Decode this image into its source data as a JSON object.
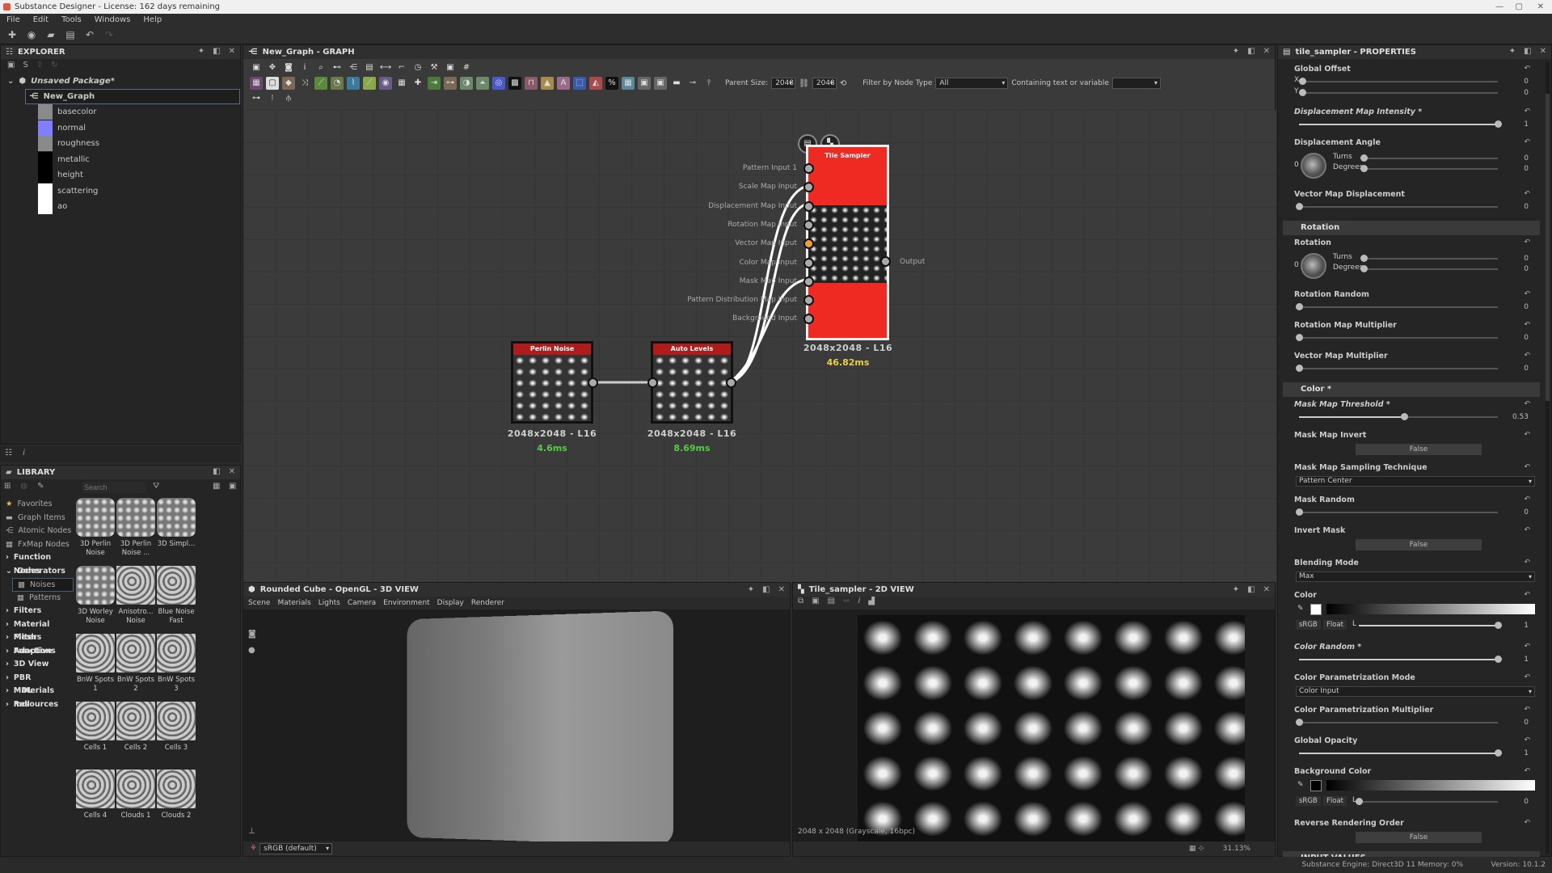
{
  "window": {
    "title": "Substance Designer - License: 162 days remaining"
  },
  "menu": [
    "File",
    "Edit",
    "Tools",
    "Windows",
    "Help"
  ],
  "explorer": {
    "title": "EXPLORER",
    "package": "Unsaved Package*",
    "graph": "New_Graph",
    "outputs": [
      {
        "name": "basecolor",
        "color": "#8a8a8a"
      },
      {
        "name": "normal",
        "color": "#7f7fff"
      },
      {
        "name": "roughness",
        "color": "#8a8a8a"
      },
      {
        "name": "metallic",
        "color": "#000000"
      },
      {
        "name": "height",
        "color": "#000000"
      },
      {
        "name": "scattering",
        "color": "#ffffff"
      },
      {
        "name": "ao",
        "color": "#ffffff"
      }
    ]
  },
  "graph": {
    "title": "New_Graph - GRAPH",
    "parent_size_label": "Parent Size:",
    "parent_size_w": "2048",
    "parent_size_h": "2048",
    "filter_label": "Filter by Node Type",
    "filter_value": "All",
    "containing_label": "Containing text or variable",
    "containing_value": "",
    "nodes": {
      "perlin": {
        "title": "Perlin Noise",
        "res": "2048x2048 - L16",
        "time": "4.6ms"
      },
      "autolevels": {
        "title": "Auto Levels",
        "res": "2048x2048 - L16",
        "time": "8.69ms"
      },
      "tile": {
        "title": "Tile Sampler",
        "res": "2048x2048 - L16",
        "time": "46.82ms",
        "output": "Output",
        "inputs": [
          "Pattern Input 1",
          "Scale Map Input",
          "Displacement Map Input",
          "Rotation Map Input",
          "Vector Map Input",
          "Color Map Input",
          "Mask Map Input",
          "Pattern Distribution Map Input",
          "Background Input"
        ]
      }
    },
    "colors": {
      "node_header": "#b01c1c",
      "tile_body": "#ee2a22",
      "time_green": "#55cc44",
      "time_yellow": "#e8d040",
      "port_active": "#f0a030"
    }
  },
  "library": {
    "title": "LIBRARY",
    "search_placeholder": "Search",
    "categories": [
      {
        "label": "Favorites",
        "icon": "star-icon"
      },
      {
        "label": "Graph Items",
        "icon": "comment-icon"
      },
      {
        "label": "Atomic Nodes",
        "icon": "nodes-icon"
      },
      {
        "label": "FxMap Nodes",
        "icon": "grid-icon"
      },
      {
        "label": "Function Nodes",
        "icon": "chevron-right-icon"
      },
      {
        "label": "Generators",
        "icon": "chevron-down-icon"
      },
      {
        "label": "Noises",
        "icon": "noise-icon",
        "selected": true
      },
      {
        "label": "Patterns",
        "icon": "pattern-icon"
      },
      {
        "label": "Filters",
        "icon": "chevron-right-icon"
      },
      {
        "label": "Material Filters",
        "icon": "chevron-right-icon"
      },
      {
        "label": "Mesh Adaptive",
        "icon": "chevron-right-icon"
      },
      {
        "label": "Functions",
        "icon": "chevron-right-icon"
      },
      {
        "label": "3D View",
        "icon": "chevron-right-icon"
      },
      {
        "label": "PBR Materials",
        "icon": "chevron-right-icon"
      },
      {
        "label": "MDL Resources",
        "icon": "chevron-right-icon"
      },
      {
        "label": "mdl",
        "icon": "chevron-right-icon"
      }
    ],
    "items": [
      "3D Perlin Noise",
      "3D Perlin Noise ...",
      "3D Simpl...",
      "3D Worley Noise",
      "Anisotro... Noise",
      "Blue Noise Fast",
      "BnW Spots 1",
      "BnW Spots 2",
      "BnW Spots 3",
      "Cells 1",
      "Cells 2",
      "Cells 3",
      "Cells 4",
      "Clouds 1",
      "Clouds 2"
    ]
  },
  "view3d": {
    "title": "Rounded Cube - OpenGL - 3D VIEW",
    "menu": [
      "Scene",
      "Materials",
      "Lights",
      "Camera",
      "Environment",
      "Display",
      "Renderer"
    ],
    "colorspace": "sRGB (default)"
  },
  "view2d": {
    "title": "Tile_sampler - 2D VIEW",
    "info": "2048 x 2048 (Grayscale, 16bpc)",
    "zoom": "31.13%"
  },
  "properties": {
    "title": "tile_sampler - PROPERTIES",
    "rows": [
      {
        "type": "xy",
        "label": "Global Offset",
        "x": "0",
        "y": "0"
      },
      {
        "type": "slider",
        "label": "Displacement Map Intensity *",
        "italic": true,
        "value": "1",
        "fraction": 1
      },
      {
        "type": "angle",
        "label": "Displacement Angle",
        "dial": "0",
        "turns_label": "Turns",
        "turns": "0",
        "degrees_label": "Degrees",
        "degrees": "0"
      },
      {
        "type": "slider",
        "label": "Vector Map Displacement",
        "value": "0",
        "fraction": 0
      },
      {
        "type": "section",
        "label": "Rotation"
      },
      {
        "type": "angle",
        "label": "Rotation",
        "dial": "0",
        "turns_label": "Turns",
        "turns": "0",
        "degrees_label": "Degrees",
        "degrees": "0"
      },
      {
        "type": "slider",
        "label": "Rotation Random",
        "value": "0",
        "fraction": 0
      },
      {
        "type": "slider",
        "label": "Rotation Map Multiplier",
        "value": "0",
        "fraction": 0
      },
      {
        "type": "slider",
        "label": "Vector Map Multiplier",
        "value": "0",
        "fraction": 0
      },
      {
        "type": "section",
        "label": "Color *"
      },
      {
        "type": "slider",
        "label": "Mask Map Threshold *",
        "italic": true,
        "value": "0.53",
        "fraction": 0.53
      },
      {
        "type": "toggle",
        "label": "Mask Map Invert",
        "value": "False"
      },
      {
        "type": "dropdown",
        "label": "Mask Map Sampling Technique",
        "value": "Pattern Center"
      },
      {
        "type": "slider",
        "label": "Mask Random",
        "value": "0",
        "fraction": 0
      },
      {
        "type": "toggle",
        "label": "Invert Mask",
        "value": "False"
      },
      {
        "type": "dropdown",
        "label": "Blending Mode",
        "value": "Max"
      },
      {
        "type": "color",
        "label": "Color",
        "swatch": "#ffffff",
        "space": "sRGB",
        "format": "Float",
        "channel": "L",
        "value": "1",
        "fraction": 1
      },
      {
        "type": "slider",
        "label": "Color Random *",
        "italic": true,
        "value": "1",
        "fraction": 1
      },
      {
        "type": "dropdown",
        "label": "Color Parametrization Mode",
        "value": "Color Input"
      },
      {
        "type": "slider",
        "label": "Color Parametrization Multiplier",
        "value": "0",
        "fraction": 0
      },
      {
        "type": "slider",
        "label": "Global Opacity",
        "value": "1",
        "fraction": 1
      },
      {
        "type": "color",
        "label": "Background Color",
        "swatch": "#000000",
        "space": "sRGB",
        "format": "Float",
        "channel": "L",
        "value": "0",
        "fraction": 0
      },
      {
        "type": "toggle",
        "label": "Reverse Rendering Order",
        "value": "False"
      },
      {
        "type": "section",
        "label": "INPUT VALUES"
      }
    ]
  },
  "status": {
    "engine": "Substance Engine: Direct3D 11  Memory: 0%",
    "version": "Version: 10.1.2"
  }
}
